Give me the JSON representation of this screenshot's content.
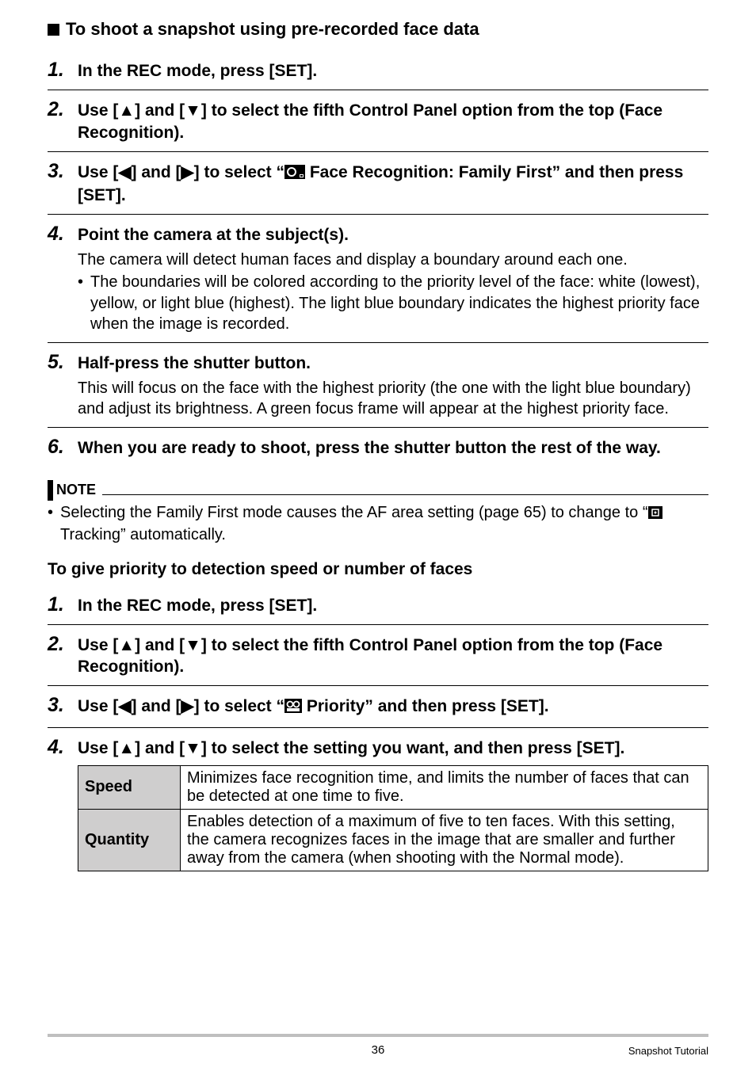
{
  "heading1": "To shoot a snapshot using pre-recorded face data",
  "stepsA": {
    "s1": {
      "num": "1.",
      "title": "In the REC mode, press [SET]."
    },
    "s2": {
      "num": "2.",
      "title": "Use [▲] and [▼] to select the fifth Control Panel option from the top (Face Recognition)."
    },
    "s3": {
      "num": "3.",
      "title_pre": "Use [◀] and [▶] to select “",
      "title_post": " Face Recognition: Family First” and then press [SET]."
    },
    "s4": {
      "num": "4.",
      "title": "Point the camera at the subject(s).",
      "body_line": "The camera will detect human faces and display a boundary around each one.",
      "body_bullet": "The boundaries will be colored according to the priority level of the face: white (lowest), yellow, or light blue (highest). The light blue boundary indicates the highest priority face when the image is recorded."
    },
    "s5": {
      "num": "5.",
      "title": "Half-press the shutter button.",
      "body": "This will focus on the face with the highest priority (the one with the light blue boundary) and adjust its brightness. A green focus frame will appear at the highest priority face."
    },
    "s6": {
      "num": "6.",
      "title": "When you are ready to shoot, press the shutter button the rest of the way."
    }
  },
  "note": {
    "label": "NOTE",
    "body_pre": "Selecting the Family First mode causes the AF area setting (page 65) to change to “",
    "body_post": " Tracking” automatically."
  },
  "subheading": "To give priority to detection speed or number of faces",
  "stepsB": {
    "s1": {
      "num": "1.",
      "title": "In the REC mode, press [SET]."
    },
    "s2": {
      "num": "2.",
      "title": "Use [▲] and [▼] to select the fifth Control Panel option from the top (Face Recognition)."
    },
    "s3": {
      "num": "3.",
      "title_pre": "Use [◀] and [▶] to select “",
      "title_post": " Priority” and then press [SET]."
    },
    "s4": {
      "num": "4.",
      "title": "Use [▲] and [▼] to select the setting you want, and then press [SET]."
    }
  },
  "table": {
    "r1": {
      "label": "Speed",
      "desc": "Minimizes face recognition time, and limits the number of faces that can be detected at one time to five."
    },
    "r2": {
      "label": "Quantity",
      "desc": "Enables detection of a maximum of five to ten faces. With this setting, the camera recognizes faces in the image that are smaller and further away from the camera (when shooting with the Normal mode)."
    }
  },
  "footer": {
    "page_num": "36",
    "section": "Snapshot Tutorial"
  }
}
